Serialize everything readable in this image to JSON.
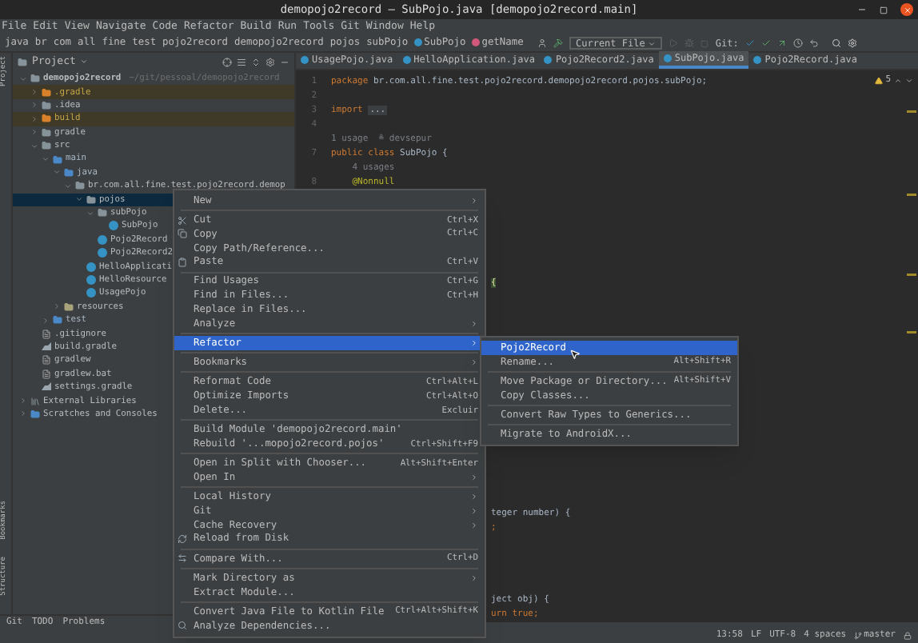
{
  "window": {
    "title": "demopojo2record – SubPojo.java [demopojo2record.main]"
  },
  "menu_bar": [
    "File",
    "Edit",
    "View",
    "Navigate",
    "Code",
    "Refactor",
    "Build",
    "Run",
    "Tools",
    "Git",
    "Window",
    "Help"
  ],
  "breadcrumbs": [
    {
      "label": "java",
      "kind": "folder"
    },
    {
      "label": "br",
      "kind": "folder"
    },
    {
      "label": "com",
      "kind": "folder"
    },
    {
      "label": "all",
      "kind": "folder"
    },
    {
      "label": "fine",
      "kind": "folder"
    },
    {
      "label": "test",
      "kind": "folder"
    },
    {
      "label": "pojo2record",
      "kind": "folder"
    },
    {
      "label": "demopojo2record",
      "kind": "folder"
    },
    {
      "label": "pojos",
      "kind": "folder"
    },
    {
      "label": "subPojo",
      "kind": "folder"
    },
    {
      "label": "SubPojo",
      "kind": "class"
    },
    {
      "label": "getName",
      "kind": "method"
    }
  ],
  "toolbar": {
    "run_config": "Current File",
    "git_label": "Git:"
  },
  "side_strip": [
    "Project",
    "Bookmarks",
    "Structure"
  ],
  "project": {
    "title": "Project",
    "tree": [
      {
        "label": "demopojo2record",
        "hint": "~/git/pessoal/demopojo2record",
        "kind": "module",
        "expanded": true,
        "selected": false,
        "children": [
          {
            "label": ".gradle",
            "kind": "excluded",
            "expanded": false,
            "selected": false
          },
          {
            "label": ".idea",
            "kind": "folder",
            "expanded": false,
            "selected": false
          },
          {
            "label": "build",
            "kind": "excluded",
            "expanded": false,
            "selected": false
          },
          {
            "label": "gradle",
            "kind": "folder",
            "expanded": false,
            "selected": false
          },
          {
            "label": "src",
            "kind": "folder",
            "expanded": true,
            "selected": false,
            "children": [
              {
                "label": "main",
                "kind": "source",
                "expanded": true,
                "selected": false,
                "children": [
                  {
                    "label": "java",
                    "kind": "source",
                    "expanded": true,
                    "selected": false,
                    "children": [
                      {
                        "label": "br.com.all.fine.test.pojo2record.demop",
                        "kind": "package",
                        "expanded": true,
                        "selected": false,
                        "children": [
                          {
                            "label": "pojos",
                            "kind": "package",
                            "expanded": true,
                            "selected": true,
                            "children": [
                              {
                                "label": "subPojo",
                                "kind": "package",
                                "expanded": true,
                                "selected": false,
                                "children": [
                                  {
                                    "label": "SubPojo",
                                    "kind": "class",
                                    "selected": false
                                  }
                                ]
                              },
                              {
                                "label": "Pojo2Record",
                                "kind": "class",
                                "selected": false
                              },
                              {
                                "label": "Pojo2Record2",
                                "kind": "class",
                                "selected": false
                              }
                            ]
                          },
                          {
                            "label": "HelloApplicati",
                            "kind": "class",
                            "selected": false
                          },
                          {
                            "label": "HelloResource",
                            "kind": "class",
                            "selected": false
                          },
                          {
                            "label": "UsagePojo",
                            "kind": "class",
                            "selected": false
                          }
                        ]
                      }
                    ]
                  },
                  {
                    "label": "resources",
                    "kind": "resources",
                    "expanded": false,
                    "selected": false
                  }
                ]
              },
              {
                "label": "test",
                "kind": "source",
                "expanded": false,
                "selected": false
              }
            ]
          },
          {
            "label": ".gitignore",
            "kind": "file",
            "selected": false
          },
          {
            "label": "build.gradle",
            "kind": "gradle",
            "selected": false
          },
          {
            "label": "gradlew",
            "kind": "file",
            "selected": false
          },
          {
            "label": "gradlew.bat",
            "kind": "file",
            "selected": false
          },
          {
            "label": "settings.gradle",
            "kind": "gradle",
            "selected": false
          }
        ]
      },
      {
        "label": "External Libraries",
        "kind": "library",
        "expanded": false,
        "selected": false
      },
      {
        "label": "Scratches and Consoles",
        "kind": "scratch",
        "expanded": false,
        "selected": false
      }
    ]
  },
  "editor": {
    "tabs": [
      {
        "label": "UsagePojo.java",
        "selected": false
      },
      {
        "label": "HelloApplication.java",
        "selected": false
      },
      {
        "label": "Pojo2Record2.java",
        "selected": false
      },
      {
        "label": "SubPojo.java",
        "selected": true
      },
      {
        "label": "Pojo2Record.java",
        "selected": false
      }
    ],
    "warnings": "5",
    "lines": [
      {
        "kind": "code",
        "number": "1",
        "tokens": [
          {
            "text": "package ",
            "kind": "keyword"
          },
          {
            "text": "br.com.all.fine.test.pojo2record.demopojo2record.pojos.subPojo;",
            "kind": "plain"
          }
        ]
      },
      {
        "kind": "code",
        "number": "2"
      },
      {
        "kind": "code",
        "number": "3",
        "tokens": [
          {
            "text": "import ",
            "kind": "keyword"
          },
          {
            "text": "...",
            "kind": "fold"
          }
        ]
      },
      {
        "kind": "code",
        "number": "4"
      },
      {
        "kind": "hint",
        "text": "1 usage  ≗ devsepur"
      },
      {
        "kind": "code",
        "number": "7",
        "tokens": [
          {
            "text": "public class ",
            "kind": "keyword"
          },
          {
            "text": "SubPojo {",
            "kind": "plain"
          }
        ]
      },
      {
        "kind": "hint",
        "text": "    4 usages"
      },
      {
        "kind": "code",
        "number": "8",
        "tokens": [
          {
            "text": "    @Nonnull",
            "kind": "annotation"
          }
        ]
      },
      {
        "kind": "blank"
      },
      {
        "kind": "blank"
      },
      {
        "kind": "blank"
      },
      {
        "kind": "blank"
      },
      {
        "kind": "blank"
      },
      {
        "kind": "blank"
      },
      {
        "kind": "partial",
        "tokens": [
          {
            "text": "{",
            "kind": "brace"
          }
        ]
      },
      {
        "kind": "blank"
      },
      {
        "kind": "blank"
      },
      {
        "kind": "blank"
      },
      {
        "kind": "blank"
      },
      {
        "kind": "blank"
      },
      {
        "kind": "blank"
      },
      {
        "kind": "blank"
      },
      {
        "kind": "blank"
      },
      {
        "kind": "blank"
      },
      {
        "kind": "blank"
      },
      {
        "kind": "blank"
      },
      {
        "kind": "blank"
      },
      {
        "kind": "blank"
      },
      {
        "kind": "blank"
      },
      {
        "kind": "blank"
      },
      {
        "kind": "partial",
        "tokens": [
          {
            "text": "teger number) {",
            "kind": "plain"
          }
        ]
      },
      {
        "kind": "partial",
        "tokens": [
          {
            "text": ";",
            "kind": "keyword"
          }
        ]
      },
      {
        "kind": "blank"
      },
      {
        "kind": "blank"
      },
      {
        "kind": "blank"
      },
      {
        "kind": "blank"
      },
      {
        "kind": "partial",
        "tokens": [
          {
            "text": "ject obj) {",
            "kind": "plain"
          }
        ]
      },
      {
        "kind": "partial",
        "tokens": [
          {
            "text": "urn true;",
            "kind": "keyword"
          }
        ]
      }
    ]
  },
  "context_menu": {
    "items": [
      {
        "kind": "item",
        "label": "New",
        "submenu": true,
        "selected": false
      },
      {
        "kind": "separator"
      },
      {
        "kind": "item",
        "label": "Cut",
        "shortcut": "Ctrl+X",
        "selected": false
      },
      {
        "kind": "item",
        "label": "Copy",
        "shortcut": "Ctrl+C",
        "selected": false
      },
      {
        "kind": "item",
        "label": "Copy Path/Reference...",
        "selected": false
      },
      {
        "kind": "item",
        "label": "Paste",
        "shortcut": "Ctrl+V",
        "selected": false
      },
      {
        "kind": "separator"
      },
      {
        "kind": "item",
        "label": "Find Usages",
        "shortcut": "Ctrl+G",
        "selected": false
      },
      {
        "kind": "item",
        "label": "Find in Files...",
        "shortcut": "Ctrl+H",
        "selected": false
      },
      {
        "kind": "item",
        "label": "Replace in Files...",
        "selected": false
      },
      {
        "kind": "item",
        "label": "Analyze",
        "submenu": true,
        "selected": false
      },
      {
        "kind": "separator"
      },
      {
        "kind": "item",
        "label": "Refactor",
        "submenu": true,
        "selected": true
      },
      {
        "kind": "separator"
      },
      {
        "kind": "item",
        "label": "Bookmarks",
        "submenu": true,
        "selected": false
      },
      {
        "kind": "separator"
      },
      {
        "kind": "item",
        "label": "Reformat Code",
        "shortcut": "Ctrl+Alt+L",
        "selected": false
      },
      {
        "kind": "item",
        "label": "Optimize Imports",
        "shortcut": "Ctrl+Alt+O",
        "selected": false
      },
      {
        "kind": "item",
        "label": "Delete...",
        "shortcut": "Excluir",
        "selected": false
      },
      {
        "kind": "separator"
      },
      {
        "kind": "item",
        "label": "Build Module 'demopojo2record.main'",
        "selected": false
      },
      {
        "kind": "item",
        "label": "Rebuild '...mopojo2record.pojos'",
        "shortcut": "Ctrl+Shift+F9",
        "selected": false
      },
      {
        "kind": "separator"
      },
      {
        "kind": "item",
        "label": "Open in Split with Chooser...",
        "shortcut": "Alt+Shift+Enter",
        "selected": false
      },
      {
        "kind": "item",
        "label": "Open In",
        "submenu": true,
        "selected": false
      },
      {
        "kind": "separator"
      },
      {
        "kind": "item",
        "label": "Local History",
        "submenu": true,
        "selected": false
      },
      {
        "kind": "item",
        "label": "Git",
        "submenu": true,
        "selected": false
      },
      {
        "kind": "item",
        "label": "Cache Recovery",
        "submenu": true,
        "selected": false
      },
      {
        "kind": "item",
        "label": "Reload from Disk",
        "selected": false
      },
      {
        "kind": "separator"
      },
      {
        "kind": "item",
        "label": "Compare With...",
        "shortcut": "Ctrl+D",
        "selected": false
      },
      {
        "kind": "separator"
      },
      {
        "kind": "item",
        "label": "Mark Directory as",
        "submenu": true,
        "selected": false
      },
      {
        "kind": "item",
        "label": "Extract Module...",
        "selected": false
      },
      {
        "kind": "separator"
      },
      {
        "kind": "item",
        "label": "Convert Java File to Kotlin File",
        "shortcut": "Ctrl+Alt+Shift+K",
        "selected": false
      },
      {
        "kind": "item",
        "label": "Analyze Dependencies...",
        "selected": false
      }
    ]
  },
  "refactor_submenu": {
    "items": [
      {
        "kind": "item",
        "label": "Pojo2Record",
        "selected": true
      },
      {
        "kind": "item",
        "label": "Rename...",
        "shortcut": "Alt+Shift+R",
        "selected": false
      },
      {
        "kind": "separator"
      },
      {
        "kind": "item",
        "label": "Move Package or Directory...",
        "shortcut": "Alt+Shift+V",
        "selected": false
      },
      {
        "kind": "item",
        "label": "Copy Classes...",
        "selected": false
      },
      {
        "kind": "separator"
      },
      {
        "kind": "item",
        "label": "Convert Raw Types to Generics...",
        "selected": false
      },
      {
        "kind": "separator"
      },
      {
        "kind": "item",
        "label": "Migrate to AndroidX...",
        "selected": false
      }
    ]
  },
  "tool_strip": [
    "Git",
    "TODO",
    "Problems"
  ],
  "status_bar": [
    "13:58",
    "LF",
    "UTF-8",
    "4 spaces",
    "master"
  ]
}
